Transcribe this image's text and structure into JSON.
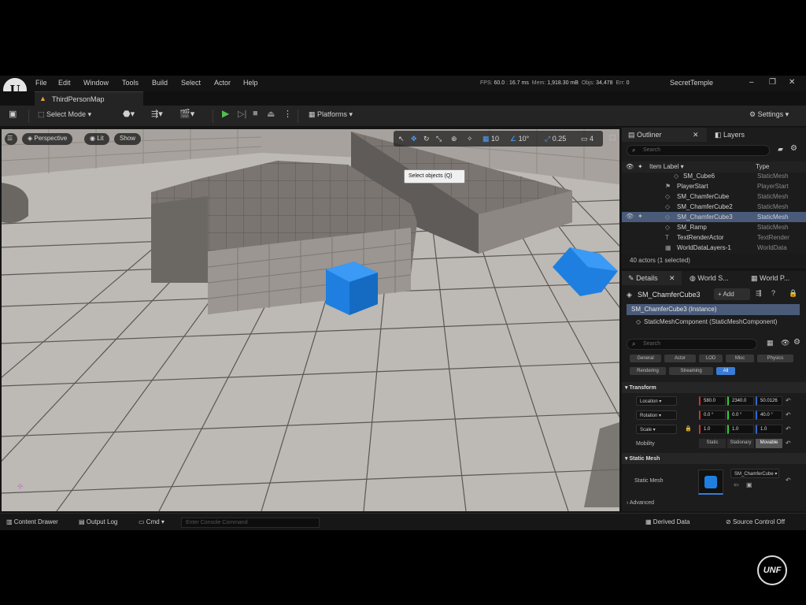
{
  "app": {
    "logo_glyph": "U",
    "project_name": "SecretTemple"
  },
  "menu": [
    "File",
    "Edit",
    "Window",
    "Tools",
    "Build",
    "Select",
    "Actor",
    "Help"
  ],
  "stats": {
    "fps_label": "FPS:",
    "fps": "60.0",
    "ms": "16.7 ms",
    "mem_label": "Mem:",
    "mem": "1,918.30 mB",
    "objs_label": "Objs:",
    "objs": "34,478",
    "err_label": "Err:",
    "err": "0"
  },
  "window_controls": {
    "minimize": "–",
    "maximize": "❐",
    "close": "✕"
  },
  "tabs": {
    "map_tab": "ThirdPersonMap"
  },
  "toolbar": {
    "select_mode": "Select Mode",
    "platforms": "Platforms",
    "settings": "Settings"
  },
  "viewport": {
    "perspective": "Perspective",
    "lit": "Lit",
    "show": "Show",
    "grid_snap": "10",
    "rot_snap": "10°",
    "scale_snap": "0.25",
    "camera_speed": "4",
    "tooltip": "Select objects (Q)"
  },
  "outliner": {
    "tab_label": "Outliner",
    "layers_label": "Layers",
    "search_placeholder": "Search",
    "col_label": "Item Label ▾",
    "col_type": "Type",
    "rows": [
      {
        "name": "SM_Cube6",
        "type": "StaticMesh"
      },
      {
        "name": "PlayerStart",
        "type": "PlayerStart"
      },
      {
        "name": "SM_ChamferCube",
        "type": "StaticMesh"
      },
      {
        "name": "SM_ChamferCube2",
        "type": "StaticMesh"
      },
      {
        "name": "SM_ChamferCube3",
        "type": "StaticMesh"
      },
      {
        "name": "SM_Ramp",
        "type": "StaticMesh"
      },
      {
        "name": "TextRenderActor",
        "type": "TextRender"
      },
      {
        "name": "WorldDataLayers-1",
        "type": "WorldData"
      }
    ],
    "actor_count": "40 actors (1 selected)"
  },
  "details": {
    "tab_label": "Details",
    "world_settings_tab": "World S...",
    "world_partition_tab": "World P...",
    "actor_name": "SM_ChamferCube3",
    "add_label": "+ Add",
    "instance_label": "SM_ChamferCube3 (Instance)",
    "component_label": "StaticMeshComponent (StaticMeshComponent)",
    "search_placeholder": "Search",
    "filters": [
      "General",
      "Actor",
      "LOD",
      "Misc",
      "Physics",
      "Rendering",
      "Streaming",
      "All"
    ],
    "transform_header": "Transform",
    "location_label": "Location",
    "location": [
      "580.0",
      "2340.0",
      "50.0126"
    ],
    "rotation_label": "Rotation",
    "rotation": [
      "0.0 °",
      "0.0 °",
      "40.0 °"
    ],
    "scale_label": "Scale",
    "scale": [
      "1.0",
      "1.0",
      "1.0"
    ],
    "mobility_label": "Mobility",
    "mobility_options": [
      "Static",
      "Stationary",
      "Movable"
    ],
    "mobility_selected": "Movable",
    "static_mesh_header": "Static Mesh",
    "static_mesh_label": "Static Mesh",
    "static_mesh_value": "SM_ChamferCube",
    "advanced": "Advanced"
  },
  "statusbar": {
    "content_drawer": "Content Drawer",
    "output_log": "Output Log",
    "cmd": "Cmd",
    "console_placeholder": "Enter Console Command",
    "derived_data": "Derived Data",
    "source_control": "Source Control Off"
  },
  "watermark": "UNF",
  "colors": {
    "accent": "#3a7bd5",
    "selection": "#4a5b7a",
    "cube": "#1f7fe0",
    "floor": "#bdb9b4"
  }
}
